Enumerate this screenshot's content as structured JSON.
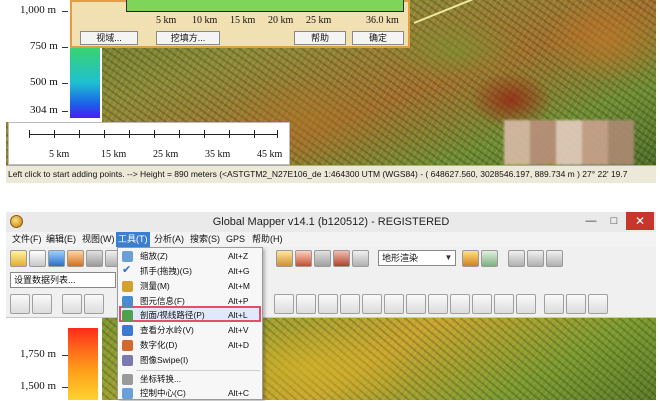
{
  "top_panel": {
    "elevation_legend": [
      {
        "label": "1,000 m"
      },
      {
        "label": "750 m"
      },
      {
        "label": "500 m"
      },
      {
        "label": "304 m"
      }
    ],
    "scale_bar": [
      "5 km",
      "15 km",
      "25 km",
      "35 km",
      "45 km"
    ],
    "profile_dialog": {
      "distance_labels": [
        "5 km",
        "10 km",
        "15 km",
        "20 km",
        "25 km",
        "36.0 km"
      ],
      "buttons": {
        "view": "视域...",
        "cut_fill": "挖填方...",
        "help": "帮助",
        "ok": "确定"
      }
    },
    "status_bar": "Left click to start adding points. --> Height = 890 meters (<ASTGTM2_N27E106_de  1:464300  UTM (WGS84) - ( 648627.560, 3028546.197, 889.734 m )  27° 22' 19.7"
  },
  "window": {
    "title": "Global Mapper v14.1 (b120512) - REGISTERED",
    "controls": {
      "minimize": "—",
      "maximize": "□",
      "close": "✕"
    },
    "menus": [
      "文件(F)",
      "编辑(E)",
      "视图(W)",
      "工具(T)",
      "分析(A)",
      "搜索(S)",
      "GPS",
      "帮助(H)"
    ],
    "layer_select_placeholder": "设置数据列表...",
    "shader_select_value": "地形渲染",
    "elevation_legend": [
      {
        "label": "1,750 m"
      },
      {
        "label": "1,500 m"
      }
    ]
  },
  "tools_menu": {
    "items": [
      {
        "label": "缩放(Z)",
        "shortcut": "Alt+Z",
        "icon": "zoom-icon",
        "color": "#6a9fd8"
      },
      {
        "label": "抓手(拖拽)(G)",
        "shortcut": "Alt+G",
        "icon": "pan-icon",
        "color": "#2a6fcf",
        "checked": true
      },
      {
        "label": "测量(M)",
        "shortcut": "Alt+M",
        "icon": "measure-icon",
        "color": "#d4a030"
      },
      {
        "label": "图元信息(F)",
        "shortcut": "Alt+P",
        "icon": "feature-info-icon",
        "color": "#4a8ad0"
      },
      {
        "label": "剖面/视线路径(P)",
        "shortcut": "Alt+L",
        "icon": "profile-icon",
        "color": "#50a050",
        "highlighted": true
      },
      {
        "label": "查看分水岭(V)",
        "shortcut": "Alt+V",
        "icon": "watershed-icon",
        "color": "#3a7ad0"
      },
      {
        "label": "数字化(D)",
        "shortcut": "Alt+D",
        "icon": "digitize-icon",
        "color": "#d06a30"
      },
      {
        "label": "图像Swipe(I)",
        "shortcut": "",
        "icon": "swipe-icon",
        "color": "#7a7ab0"
      },
      {
        "label": "坐标转换...",
        "shortcut": "",
        "icon": "coord-convert-icon",
        "color": "#9a9a9a"
      },
      {
        "label": "控制中心(C)",
        "shortcut": "Alt+C",
        "icon": "control-center-icon",
        "color": "#6aa0d8"
      }
    ]
  }
}
